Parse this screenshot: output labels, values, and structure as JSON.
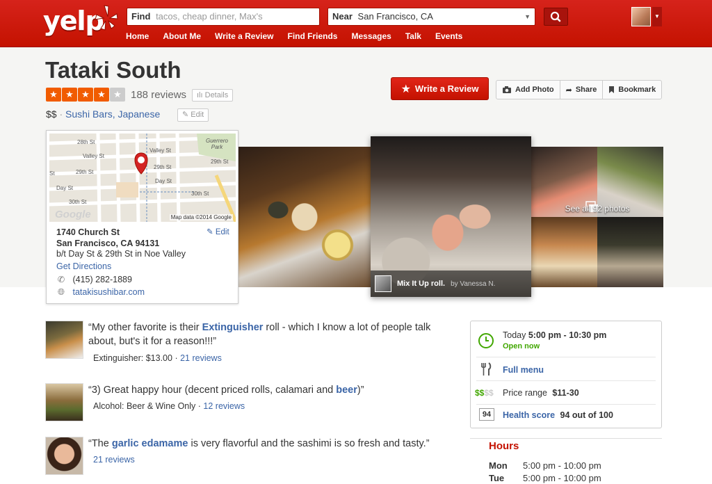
{
  "header": {
    "logo": "yelp",
    "find_label": "Find",
    "find_placeholder": "tacos, cheap dinner, Max's",
    "near_label": "Near",
    "near_value": "San Francisco, CA",
    "nav": [
      "Home",
      "About Me",
      "Write a Review",
      "Find Friends",
      "Messages",
      "Talk",
      "Events"
    ]
  },
  "business": {
    "name": "Tataki South",
    "rating": 4,
    "rating_max": 5,
    "review_count": "188 reviews",
    "details_label": "Details",
    "price": "$$",
    "categories": "Sushi Bars, Japanese",
    "edit_label": "Edit"
  },
  "actions": {
    "write_review": "Write a Review",
    "add_photo": "Add Photo",
    "share": "Share",
    "bookmark": "Bookmark"
  },
  "map": {
    "streets": [
      "28th St",
      "Valley St",
      "29th St",
      "Day St",
      "30th St",
      "Guerrero Park",
      "St"
    ],
    "footer": "Map data ©2014 Google",
    "google": "Google"
  },
  "location": {
    "street": "1740 Church St",
    "city": "San Francisco, CA 94131",
    "cross": "b/t Day St & 29th St in Noe Valley",
    "edit": "Edit",
    "directions": "Get Directions",
    "phone": "(415) 282-1889",
    "website": "tatakisushibar.com"
  },
  "photos": {
    "caption_title": "Mix It Up roll.",
    "caption_by": "by Vanessa N.",
    "see_all": "See all 92 photos"
  },
  "highlights": [
    {
      "quote_pre": "“My other favorite is their ",
      "quote_bold": "Extinguisher",
      "quote_post": " roll - which I know a lot of people talk about, but's it for a reason!!!”",
      "meta_text": "Extinguisher: $13.00 · ",
      "meta_link": "21 reviews"
    },
    {
      "quote_pre": "“3) Great happy hour (decent priced rolls, calamari and ",
      "quote_bold": "beer",
      "quote_post": ")”",
      "meta_text": "Alcohol: Beer & Wine Only · ",
      "meta_link": "12 reviews"
    },
    {
      "quote_pre": "“The ",
      "quote_bold": "garlic edamame",
      "quote_post": " is very flavorful and the sashimi is so fresh and tasty.”",
      "meta_text": "",
      "meta_link": "21 reviews"
    }
  ],
  "info": {
    "today_label": "Today",
    "today_hours": "5:00 pm - 10:30 pm",
    "open_now": "Open now",
    "full_menu": "Full menu",
    "price_symbol_active": "$$",
    "price_symbol_inactive": "$$",
    "price_range_label": "Price range",
    "price_range_value": "$11-30",
    "health_badge": "94",
    "health_label": "Health score",
    "health_value": "94 out of 100"
  },
  "hours": {
    "title": "Hours",
    "rows": [
      {
        "day": "Mon",
        "time": "5:00 pm - 10:00 pm"
      },
      {
        "day": "Tue",
        "time": "5:00 pm - 10:00 pm"
      }
    ]
  },
  "colors": {
    "brand_red": "#c41200",
    "star_orange": "#f15c00",
    "link_blue": "#3b65a7",
    "open_green": "#41a700"
  }
}
